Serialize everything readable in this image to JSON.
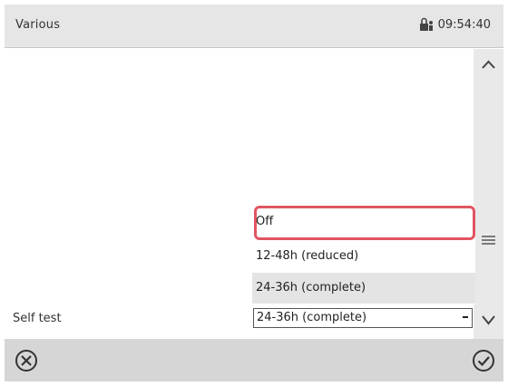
{
  "header": {
    "title": "Various",
    "time": "09:54:40"
  },
  "dropdown": {
    "options": [
      "Off",
      "12-48h (reduced)",
      "24-36h (complete)"
    ],
    "selected_index": 2,
    "highlighted_option": "Off"
  },
  "setting": {
    "label": "Self test",
    "value": "24-36h (complete)"
  },
  "icons": {
    "lock": "lock-person-icon",
    "scroll_up": "chevron-up-icon",
    "scroll_thumb": "menu-lines-icon",
    "scroll_down": "chevron-down-icon",
    "cancel": "cancel-circle-icon",
    "confirm": "check-circle-icon"
  },
  "colors": {
    "highlight": "#e05561",
    "titlebar": "#e6e6e6",
    "bottombar": "#d6d6d6"
  }
}
